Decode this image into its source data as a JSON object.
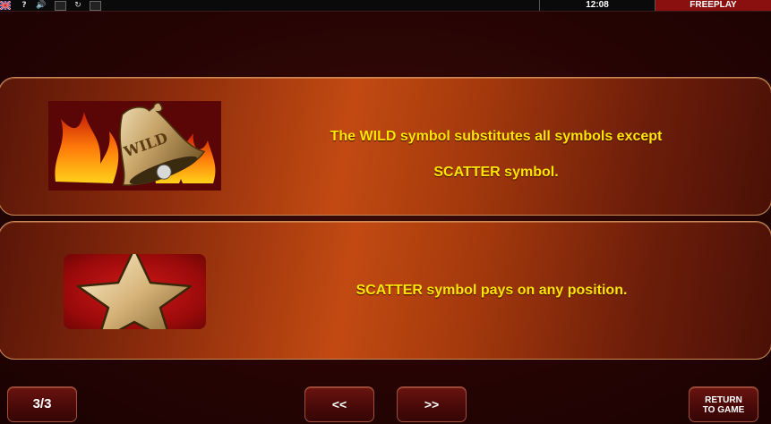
{
  "topbar": {
    "time": "12:08",
    "mode": "FREEPLAY",
    "icons": [
      "uk-flag-icon",
      "help-icon",
      "sound-icon",
      "fullscreen-icon",
      "refresh-icon",
      "settings-icon"
    ],
    "help_glyph": "?",
    "sound_glyph": "🔊",
    "refresh_glyph": "↻"
  },
  "panels": [
    {
      "symbol": "wild-bell",
      "symbol_text": "WILD",
      "line1": "The WILD symbol substitutes all symbols except",
      "line2": "SCATTER symbol."
    },
    {
      "symbol": "scatter-star",
      "text": "SCATTER symbol pays on any position."
    }
  ],
  "nav": {
    "page_indicator": "3/3",
    "prev_label": "<<",
    "next_label": ">>",
    "return_line1": "RETURN",
    "return_line2": "TO GAME"
  },
  "colors": {
    "text_accent": "#ffe600",
    "mode_badge": "#8a0f0f",
    "panel_mid": "#c24a12"
  }
}
